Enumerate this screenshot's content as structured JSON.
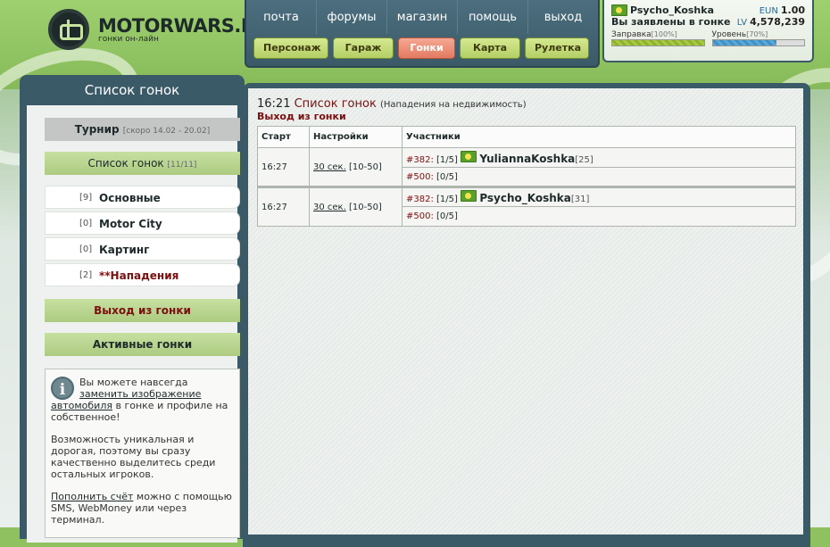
{
  "logo": {
    "title": "MOTORWARS.RU",
    "subtitle": "гонки он-лайн"
  },
  "topnav": {
    "links": [
      "почта",
      "форумы",
      "магазин",
      "помощь",
      "выход"
    ],
    "buttons": [
      "Персонаж",
      "Гараж",
      "Гонки",
      "Карта",
      "Рулетка"
    ],
    "active_button": "Гонки"
  },
  "user": {
    "name": "Psycho_Koshka",
    "status": "Вы заявлены в гонке",
    "eun_label": "EUN",
    "eun_value": "1.00",
    "lv_label": "LV",
    "lv_value": "4,578,239",
    "fuel_label": "Заправка",
    "fuel_pct": "[100%]",
    "fuel_fraction": 1.0,
    "level_label": "Уровень",
    "level_pct": "[70%]",
    "level_fraction": 0.7
  },
  "sidebar": {
    "title": "Список гонок",
    "tournament_label": "Турнир",
    "tournament_note": "[скоро 14.02 - 20.02]",
    "list_label": "Список гонок",
    "list_count": "[11/11]",
    "categories": [
      {
        "count": "[9]",
        "name": "Основные"
      },
      {
        "count": "[0]",
        "name": "Motor City"
      },
      {
        "count": "[0]",
        "name": "Картинг"
      },
      {
        "count": "[2]",
        "name": "**Нападения"
      }
    ],
    "exit_label": "Выход из гонки",
    "active_label": "Активные гонки",
    "info": {
      "p1_a": "Вы можете навсегда ",
      "p1_link": "заменить изображение автомобиля",
      "p1_b": " в гонке и профиле на собственное!",
      "p2": "Возможность уникальная и дорогая, поэтому вы сразу качественно выделитесь среди остальных игроков.",
      "p3_link": "Пополнить счёт",
      "p3_b": " можно с помощью SMS, WebMoney или через терминал."
    }
  },
  "main": {
    "time": "16:21",
    "title": "Список гонок",
    "note": "(Нападения на недвижимость)",
    "exit_label": "Выход из гонки",
    "table": {
      "headers": [
        "Старт",
        "Настройки",
        "Участники"
      ],
      "rows": [
        {
          "start": "16:27",
          "setting_link": "30 сек.",
          "setting_range": "[10-50]",
          "p1_id": "#382:",
          "p1_slots": "[1/5]",
          "p1_name": "YuliannaKoshka",
          "p1_lv": "[25]",
          "p2_id": "#500:",
          "p2_slots": "[0/5]"
        },
        {
          "start": "16:27",
          "setting_link": "30 сек.",
          "setting_range": "[10-50]",
          "p1_id": "#382:",
          "p1_slots": "[1/5]",
          "p1_name": "Psycho_Koshka",
          "p1_lv": "[31]",
          "p2_id": "#500:",
          "p2_slots": "[0/5]"
        }
      ]
    }
  }
}
